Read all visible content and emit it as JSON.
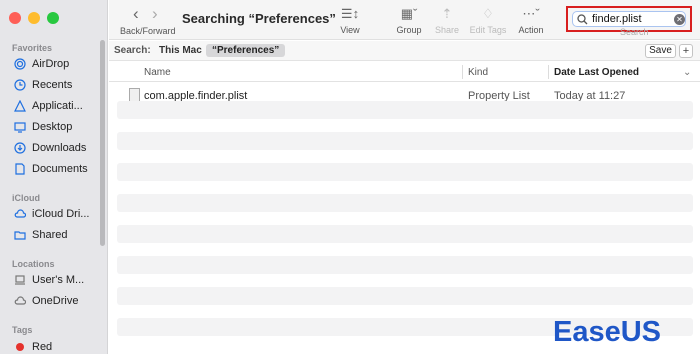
{
  "window": {
    "title": "Searching “Preferences”",
    "nav_label": "Back/Forward"
  },
  "toolbar": {
    "view_label": "View",
    "group_label": "Group",
    "share_label": "Share",
    "edit_tags_label": "Edit Tags",
    "action_label": "Action",
    "search_label": "Search"
  },
  "search": {
    "value": "finder.plist"
  },
  "scope": {
    "label": "Search:",
    "this_mac": "This Mac",
    "selected": "“Preferences”",
    "save_label": "Save",
    "add_label": "+"
  },
  "columns": {
    "name": "Name",
    "kind": "Kind",
    "date": "Date Last Opened"
  },
  "files": [
    {
      "name": "com.apple.finder.plist",
      "kind": "Property List",
      "date": "Today at 11:27"
    }
  ],
  "sidebar": {
    "favorites_header": "Favorites",
    "favorites": [
      {
        "label": "AirDrop",
        "icon": "airdrop-icon"
      },
      {
        "label": "Recents",
        "icon": "clock-icon"
      },
      {
        "label": "Applicati...",
        "icon": "applications-icon"
      },
      {
        "label": "Desktop",
        "icon": "desktop-icon"
      },
      {
        "label": "Downloads",
        "icon": "download-icon"
      },
      {
        "label": "Documents",
        "icon": "document-icon"
      }
    ],
    "icloud_header": "iCloud",
    "icloud": [
      {
        "label": "iCloud Dri...",
        "icon": "cloud-icon"
      },
      {
        "label": "Shared",
        "icon": "shared-folder-icon"
      }
    ],
    "locations_header": "Locations",
    "locations": [
      {
        "label": "User's M...",
        "icon": "laptop-icon"
      },
      {
        "label": "OneDrive",
        "icon": "cloud-icon"
      }
    ],
    "tags_header": "Tags",
    "tags": [
      {
        "label": "Red",
        "color": "#e5322d"
      }
    ]
  },
  "watermark": "EaseUS",
  "colors": {
    "accent": "#1e6fe0",
    "highlight_border": "#d81e1e",
    "watermark": "#1f57c7"
  }
}
